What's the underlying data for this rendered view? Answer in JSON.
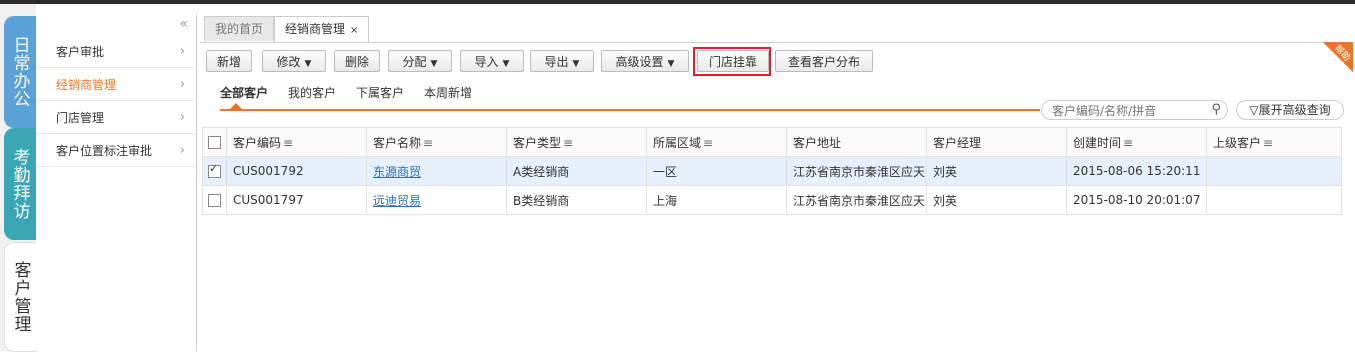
{
  "vtabs": [
    "日常办公",
    "考勤拜访",
    "客户管理"
  ],
  "submenu": {
    "collapse_icon": "«",
    "items": [
      {
        "label": "客户审批"
      },
      {
        "label": "经销商管理"
      },
      {
        "label": "门店管理"
      },
      {
        "label": "客户位置标注审批"
      }
    ]
  },
  "page_tabs": {
    "home": "我的首页",
    "current": "经销商管理",
    "close": "×"
  },
  "toolbar": {
    "add": "新增",
    "edit": "修改",
    "delete": "删除",
    "assign": "分配",
    "import": "导入",
    "export": "导出",
    "advanced": "高级设置",
    "store_attach": "门店挂靠",
    "view_distribution": "查看客户分布",
    "dropdown_glyph": "▼"
  },
  "help_label": "帮助",
  "subtabs": [
    "全部客户",
    "我的客户",
    "下属客户",
    "本周新增"
  ],
  "search": {
    "placeholder": "客户编码/名称/拼音",
    "icon": "🔍"
  },
  "advanced_query": "展开高级查询",
  "table": {
    "columns": [
      "客户编码",
      "客户名称",
      "客户类型",
      "所属区域",
      "客户地址",
      "客户经理",
      "创建时间",
      "上级客户"
    ],
    "rows": [
      {
        "checked": true,
        "code": "CUS001792",
        "name": "东源商贸",
        "type": "A类经销商",
        "region": "一区",
        "address": "江苏省南京市秦淮区应天",
        "manager": "刘英",
        "created": "2015-08-06 15:20:11",
        "parent": ""
      },
      {
        "checked": false,
        "code": "CUS001797",
        "name": "远迪贸易",
        "type": "B类经销商",
        "region": "上海",
        "address": "江苏省南京市秦淮区应天",
        "manager": "刘英",
        "created": "2015-08-10 20:01:07",
        "parent": ""
      }
    ]
  },
  "colors": {
    "accent": "#e8772e",
    "highlight": "#d9232c",
    "tab_blue": "#5aa1d8",
    "tab_teal": "#3aa6b3"
  }
}
